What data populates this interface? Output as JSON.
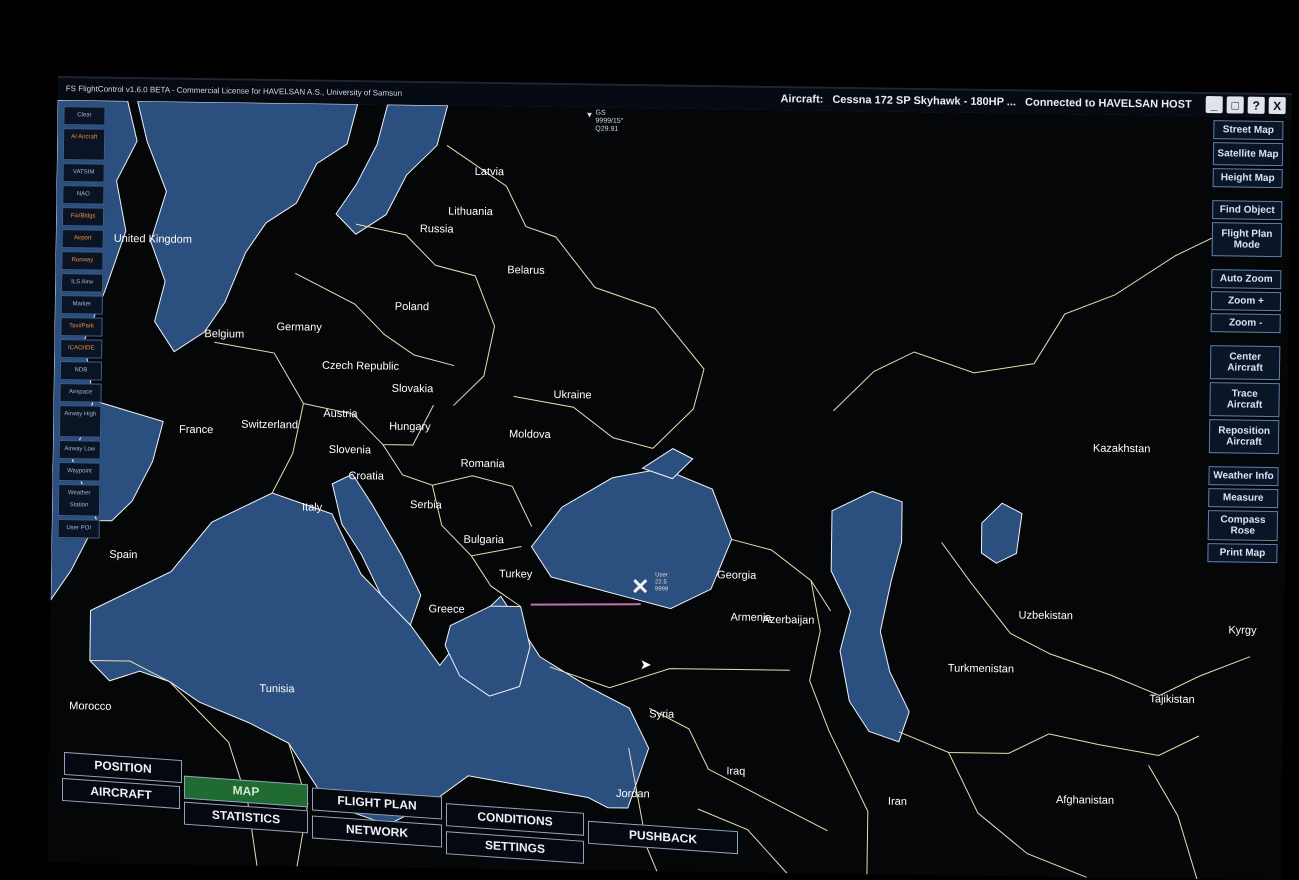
{
  "titlebar": {
    "app_title": "FS FlightControl v1.6.0 BETA - Commercial License for HAVELSAN A.S., University of Samsun",
    "aircraft_label": "Aircraft:",
    "aircraft_name": "Cessna 172 SP Skyhawk - 180HP ...",
    "connection": "Connected to HAVELSAN HOST",
    "controls": [
      "_",
      "□",
      "?",
      "X"
    ]
  },
  "left_toolbar": {
    "items": [
      {
        "label": "Clear",
        "color": "blue"
      },
      {
        "label": "AI Aircraft",
        "color": "orange"
      },
      {
        "label": "VATSIM",
        "color": "blue"
      },
      {
        "label": "NAO",
        "color": "blue"
      },
      {
        "label": "Fix/Bldgs",
        "color": "orange"
      },
      {
        "label": "Airport",
        "color": "orange"
      },
      {
        "label": "Runway",
        "color": "orange"
      },
      {
        "label": "ILS   Airw",
        "color": "blue"
      },
      {
        "label": "Marker",
        "color": "blue"
      },
      {
        "label": "Taxi/Park",
        "color": "orange"
      },
      {
        "label": "ICAO/IDE",
        "color": "orange"
      },
      {
        "label": "NDB",
        "color": "blue"
      },
      {
        "label": "Airspace",
        "color": "blue"
      },
      {
        "label": "Airway High",
        "color": "blue"
      },
      {
        "label": "Airway Low",
        "color": "blue"
      },
      {
        "label": "Waypoint",
        "color": "blue"
      },
      {
        "label": "Weather Station",
        "color": "blue"
      },
      {
        "label": "User POI",
        "color": "blue"
      }
    ]
  },
  "right_toolbar": {
    "items": [
      {
        "label": "Street Map"
      },
      {
        "label": "Satellite Map"
      },
      {
        "label": "Height Map"
      },
      {
        "label": "Find Object"
      },
      {
        "label": "Flight Plan Mode"
      },
      {
        "label": "Auto Zoom"
      },
      {
        "label": "Zoom +"
      },
      {
        "label": "Zoom -"
      },
      {
        "label": "Center Aircraft"
      },
      {
        "label": "Trace Aircraft"
      },
      {
        "label": "Reposition Aircraft"
      },
      {
        "label": "Weather Info"
      },
      {
        "label": "Measure"
      },
      {
        "label": "Compass Rose"
      },
      {
        "label": "Print Map"
      }
    ]
  },
  "hud": {
    "line1": "GS",
    "line2": "9999/15\"",
    "line3": "Q29.91"
  },
  "countries": [
    {
      "name": "Latvia"
    },
    {
      "name": "Lithuania"
    },
    {
      "name": "Russia"
    },
    {
      "name": "Belarus"
    },
    {
      "name": "Poland"
    },
    {
      "name": "Germany"
    },
    {
      "name": "Belgium"
    },
    {
      "name": "Czech Republic"
    },
    {
      "name": "Slovakia"
    },
    {
      "name": "Ukraine"
    },
    {
      "name": "Austria"
    },
    {
      "name": "Hungary"
    },
    {
      "name": "Moldova"
    },
    {
      "name": "France"
    },
    {
      "name": "Switzerland"
    },
    {
      "name": "Slovenia"
    },
    {
      "name": "Croatia"
    },
    {
      "name": "Romania"
    },
    {
      "name": "Serbia"
    },
    {
      "name": "Italy"
    },
    {
      "name": "Bulgaria"
    },
    {
      "name": "Spain"
    },
    {
      "name": "Georgia"
    },
    {
      "name": "Turkey"
    },
    {
      "name": "Greece"
    },
    {
      "name": "Armenia"
    },
    {
      "name": "Azerbaijan"
    },
    {
      "name": "Kazakhstan"
    },
    {
      "name": "Uzbekistan"
    },
    {
      "name": "Turkmenistan"
    },
    {
      "name": "Kyrgy"
    },
    {
      "name": "Tajikistan"
    },
    {
      "name": "Syria"
    },
    {
      "name": "Iraq"
    },
    {
      "name": "Iran"
    },
    {
      "name": "Afghanistan"
    },
    {
      "name": "Jordan"
    },
    {
      "name": "Tunisia"
    },
    {
      "name": "Morocco"
    },
    {
      "name": "United Kingdom"
    }
  ],
  "bottom_tabs": [
    {
      "label": "POSITION",
      "active": false
    },
    {
      "label": "AIRCRAFT",
      "active": false
    },
    {
      "label": "MAP",
      "active": true
    },
    {
      "label": "STATISTICS",
      "active": false
    },
    {
      "label": "FLIGHT PLAN",
      "active": false
    },
    {
      "label": "NETWORK",
      "active": false
    },
    {
      "label": "CONDITIONS",
      "active": false
    },
    {
      "label": "SETTINGS",
      "active": false
    },
    {
      "label": "PUSHBACK",
      "active": false
    }
  ],
  "colors": {
    "sea": "#2b4f7e",
    "land": "#050608",
    "border": "#e6dfb0",
    "coast": "#f0f3f8",
    "tab_active": "#1f6b32",
    "route": "#c86eb8",
    "button_border": "#5d7fae"
  },
  "aircraft_tag": {
    "line1": "User",
    "line2": "22.5",
    "line3": "9999"
  }
}
